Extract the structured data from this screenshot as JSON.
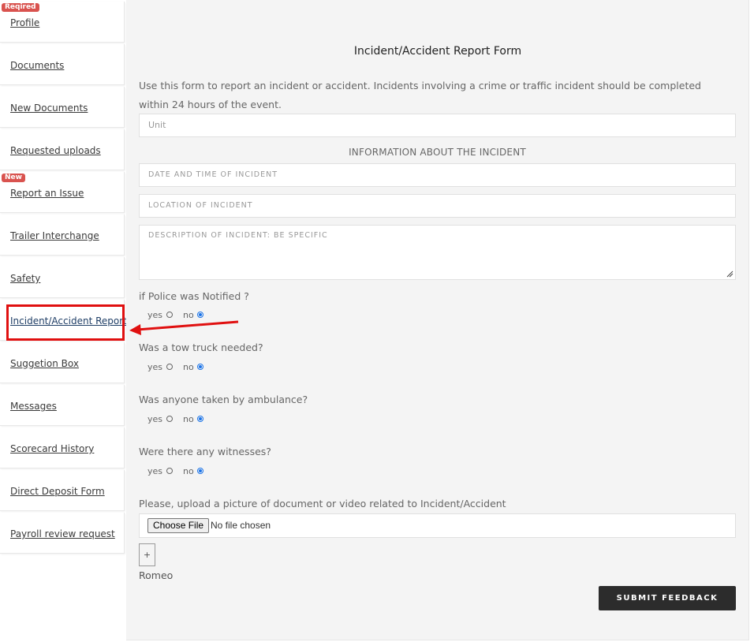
{
  "sidebar": {
    "items": [
      {
        "label": "Profile",
        "badge": "Reqired"
      },
      {
        "label": "Documents"
      },
      {
        "label": "New Documents"
      },
      {
        "label": "Requested uploads"
      },
      {
        "label": "Report an Issue",
        "badge": "New"
      },
      {
        "label": "Trailer Interchange"
      },
      {
        "label": "Safety"
      },
      {
        "label": "Incident/Accident Report",
        "highlighted": true
      },
      {
        "label": "Suggetion Box"
      },
      {
        "label": "Messages"
      },
      {
        "label": "Scorecard History"
      },
      {
        "label": "Direct Deposit Form"
      },
      {
        "label": "Payroll review request"
      }
    ]
  },
  "form": {
    "title": "Incident/Accident Report Form",
    "intro": "Use this form to report an incident or accident. Incidents involving a crime or traffic incident should be completed within 24 hours of the event.",
    "unit_placeholder": "Unit",
    "section_heading": "INFORMATION ABOUT THE INCIDENT",
    "date_placeholder": "DATE AND TIME OF INCIDENT",
    "location_placeholder": "LOCATION OF INCIDENT",
    "description_placeholder": "DESCRIPTION OF INCIDENT: BE SPECIFIC",
    "questions": [
      {
        "label": "if Police was Notified ?",
        "yes": "yes",
        "no": "no",
        "selected": "no"
      },
      {
        "label": "Was a tow truck needed?",
        "yes": "yes",
        "no": "no",
        "selected": "no"
      },
      {
        "label": "Was anyone taken by ambulance?",
        "yes": "yes",
        "no": "no",
        "selected": "no"
      },
      {
        "label": "Were there any witnesses?",
        "yes": "yes",
        "no": "no",
        "selected": "no"
      }
    ],
    "upload_label": "Please, upload a picture of document or video related to Incident/Accident",
    "choose_file": "Choose File",
    "no_file": "No file chosen",
    "add_button": "+",
    "signature_name": "Romeo",
    "submit": "SUBMIT FEEDBACK"
  },
  "colors": {
    "badge": "#d9534f",
    "highlight": "#e01010",
    "radio_selected": "#1a73e8",
    "submit_bg": "#2c2c2c"
  }
}
